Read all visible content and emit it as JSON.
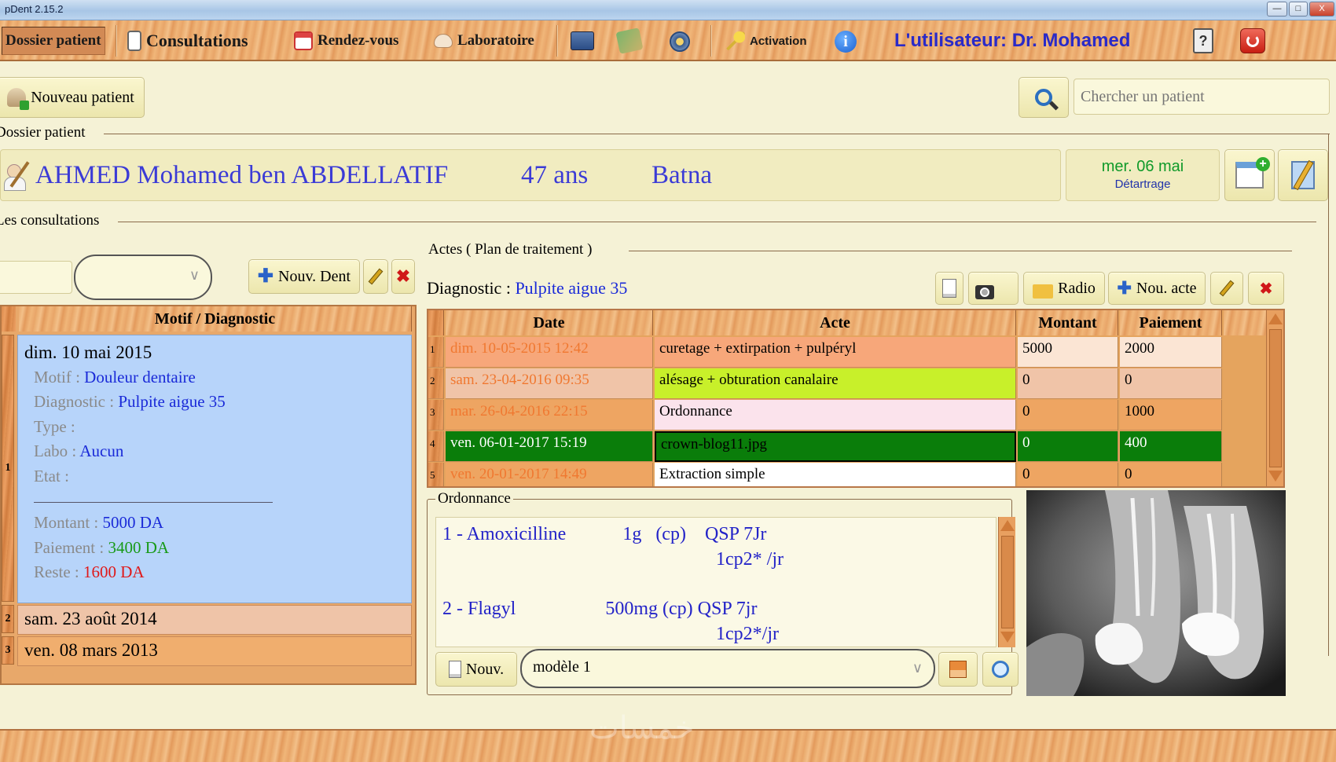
{
  "window": {
    "title": "pDent 2.15.2",
    "min": "—",
    "max": "□",
    "close": "X"
  },
  "menu": {
    "items": [
      {
        "label": "Dossier patient"
      },
      {
        "label": "Consultations"
      },
      {
        "label": "Rendez-vous"
      },
      {
        "label": "Laboratoire"
      },
      {
        "label": "Activation"
      }
    ],
    "user_label": "L'utilisateur:  Dr. Mohamed"
  },
  "toolbar": {
    "new_patient": "Nouveau patient",
    "search_placeholder": "Chercher un patient"
  },
  "dossier": {
    "section_title": "Dossier patient",
    "patient_name": "AHMED Mohamed ben ABDELLATIF",
    "age": "47  ans",
    "city": "Batna",
    "next_rdv_date": "mer. 06 mai",
    "next_rdv_label": "Détartrage"
  },
  "consultations": {
    "section_title": "Les consultations",
    "new_tooth_btn": "Nouv. Dent",
    "column_header": "Motif / Diagnostic",
    "selected": {
      "date": "dim. 10 mai 2015",
      "motif_label": "Motif : ",
      "motif": "Douleur dentaire",
      "diag_label": "Diagnostic : ",
      "diag": "Pulpite aigue 35",
      "type_label": "Type :",
      "labo_label": "Labo : ",
      "labo": "Aucun",
      "etat_label": "Etat :",
      "montant_label": "Montant : ",
      "montant": "5000 DA",
      "paiement_label": "Paiement : ",
      "paiement": "3400 DA",
      "reste_label": "Reste : ",
      "reste": "1600 DA"
    },
    "rows": [
      {
        "num": "1"
      },
      {
        "num": "2",
        "date": "sam. 23 août 2014"
      },
      {
        "num": "3",
        "date": "ven. 08 mars 2013"
      }
    ]
  },
  "actes": {
    "section_title": "Actes  ( Plan de traitement )",
    "diag_label": "Diagnostic : ",
    "diag_value": "Pulpite aigue 35",
    "btn_radio": "Radio",
    "btn_new_acte": "Nou. acte",
    "columns": [
      "Date",
      "Acte",
      "Montant",
      "Paiement"
    ],
    "rows": [
      {
        "num": "1",
        "date": "dim. 10-05-2015 12:42",
        "acte": "curetage + extirpation + pulpéryl",
        "montant": "5000",
        "paiement": "2000"
      },
      {
        "num": "2",
        "date": "sam. 23-04-2016 09:35",
        "acte": "alésage + obturation canalaire",
        "montant": "0",
        "paiement": "0"
      },
      {
        "num": "3",
        "date": "mar. 26-04-2016 22:15",
        "acte": "Ordonnance",
        "montant": "0",
        "paiement": "1000"
      },
      {
        "num": "4",
        "date": "ven. 06-01-2017 15:19",
        "acte": "crown-blog11.jpg",
        "montant": "0",
        "paiement": "400"
      },
      {
        "num": "5",
        "date": "ven. 20-01-2017 14:49",
        "acte": "Extraction simple",
        "montant": "0",
        "paiement": "0"
      }
    ],
    "colors": {
      "row1": "#f7a77a",
      "row2_acte": "#c8f02a",
      "row3_acte": "#fbe3ec",
      "row4": "#0a7d0a",
      "row5_acte": "#ffffff"
    }
  },
  "ordonnance": {
    "section_title": "Ordonnance",
    "lines": [
      "1 - Amoxicilline            1g   (cp)    QSP 7Jr",
      "1cp2* /jr",
      "2 - Flagyl                   500mg (cp) QSP 7jr",
      "1cp2*/jr"
    ],
    "new_btn": "Nouv.",
    "model_value": "modèle 1"
  },
  "watermark": "خمسات"
}
